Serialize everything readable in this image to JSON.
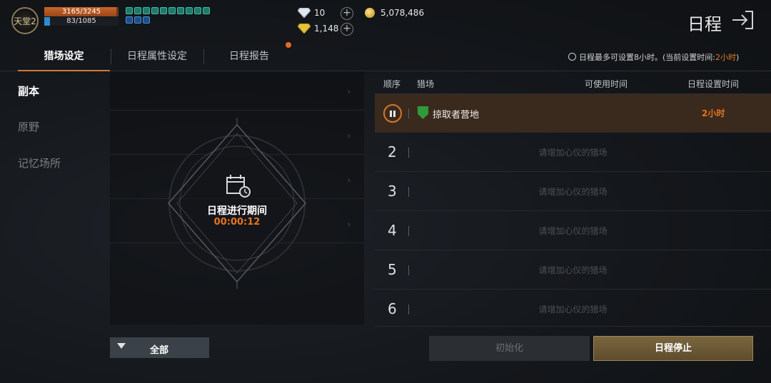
{
  "player": {
    "logo_text": "天堂2",
    "hp_text": "3165/3245",
    "hp_fraction": 0.975,
    "mp_text": "83/1085",
    "mp_fraction": 0.077
  },
  "currency": {
    "diamond": "10",
    "gold_gem": "1,148",
    "adena": "5,078,486"
  },
  "header": {
    "title": "日程"
  },
  "tabs": [
    {
      "label": "猎场设定"
    },
    {
      "label": "日程属性设定"
    },
    {
      "label": "日程报告"
    }
  ],
  "schedule_info": {
    "prefix": "日程最多可设置8小时。(当前设置时间:",
    "current": "2小时",
    "suffix": ")"
  },
  "sidebar": {
    "items": [
      {
        "label": "副本"
      },
      {
        "label": "原野"
      },
      {
        "label": "记忆场所"
      }
    ]
  },
  "overlay": {
    "label": "日程进行期间",
    "timer": "00:00:12"
  },
  "filter": {
    "label": "全部"
  },
  "table": {
    "headers": [
      "顺序",
      "猎场",
      "可使用时间",
      "日程设置时间"
    ],
    "active_row": {
      "name": "掠取者营地",
      "time": "2小时"
    },
    "empty_rows": [
      {
        "num": "2",
        "text": "请增加心仪的猎场"
      },
      {
        "num": "3",
        "text": "请增加心仪的猎场"
      },
      {
        "num": "4",
        "text": "请增加心仪的猎场"
      },
      {
        "num": "5",
        "text": "请增加心仪的猎场"
      },
      {
        "num": "6",
        "text": "请增加心仪的猎场"
      }
    ]
  },
  "buttons": {
    "reset": "初始化",
    "stop": "日程停止"
  },
  "colors": {
    "accent": "#e5741f",
    "active_row": "#3a2a1e",
    "shield": "#2f9a3a"
  }
}
